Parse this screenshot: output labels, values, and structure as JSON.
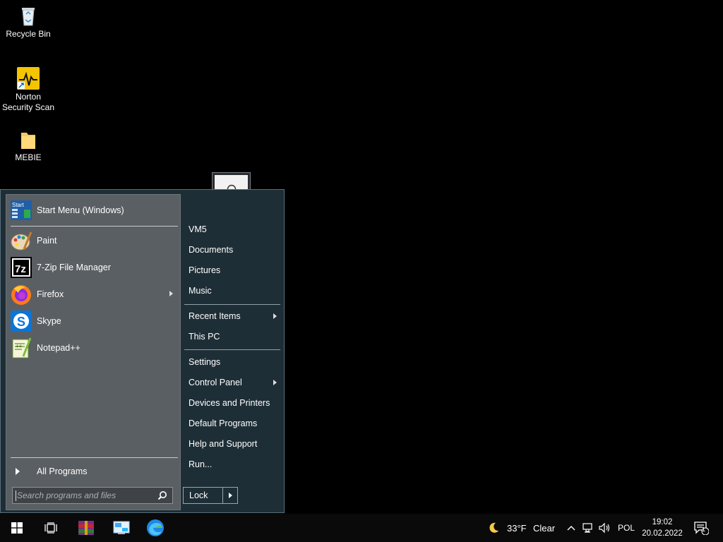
{
  "desktop": {
    "icons": [
      {
        "label": "Recycle Bin",
        "icon": "recycle-bin-icon"
      },
      {
        "label": "Norton\nSecurity Scan",
        "line1": "Norton",
        "line2": "Security Scan",
        "icon": "norton-icon"
      },
      {
        "label": "MEBIE",
        "icon": "folder-icon"
      }
    ]
  },
  "start_menu": {
    "pinned": {
      "label": "Start Menu (Windows)",
      "icon": "start-menu-icon"
    },
    "programs": [
      {
        "label": "Paint",
        "icon": "paint-icon"
      },
      {
        "label": "7-Zip File Manager",
        "icon": "7zip-icon"
      },
      {
        "label": "Firefox",
        "icon": "firefox-icon",
        "has_submenu": true
      },
      {
        "label": "Skype",
        "icon": "skype-icon"
      },
      {
        "label": "Notepad++",
        "icon": "notepadpp-icon"
      }
    ],
    "all_programs": "All Programs",
    "search_placeholder": "Search programs and files",
    "right_items": [
      {
        "label": "VM5"
      },
      {
        "label": "Documents"
      },
      {
        "label": "Pictures"
      },
      {
        "label": "Music"
      },
      {
        "label": "Recent Items",
        "has_submenu": true
      },
      {
        "label": "This PC"
      },
      {
        "label": "Settings"
      },
      {
        "label": "Control Panel",
        "has_submenu": true
      },
      {
        "label": "Devices and Printers"
      },
      {
        "label": "Default Programs"
      },
      {
        "label": "Help and Support"
      },
      {
        "label": "Run..."
      }
    ],
    "lock_label": "Lock"
  },
  "taskbar": {
    "weather_temp": "33°F",
    "weather_cond": "Clear",
    "language": "POL",
    "time": "19:02",
    "date": "20.02.2022",
    "notification_count": "1"
  },
  "colors": {
    "menu_bg": "#1e2e36",
    "left_pane_bg": "#5a5f63",
    "taskbar_bg": "#0a0a0a"
  }
}
